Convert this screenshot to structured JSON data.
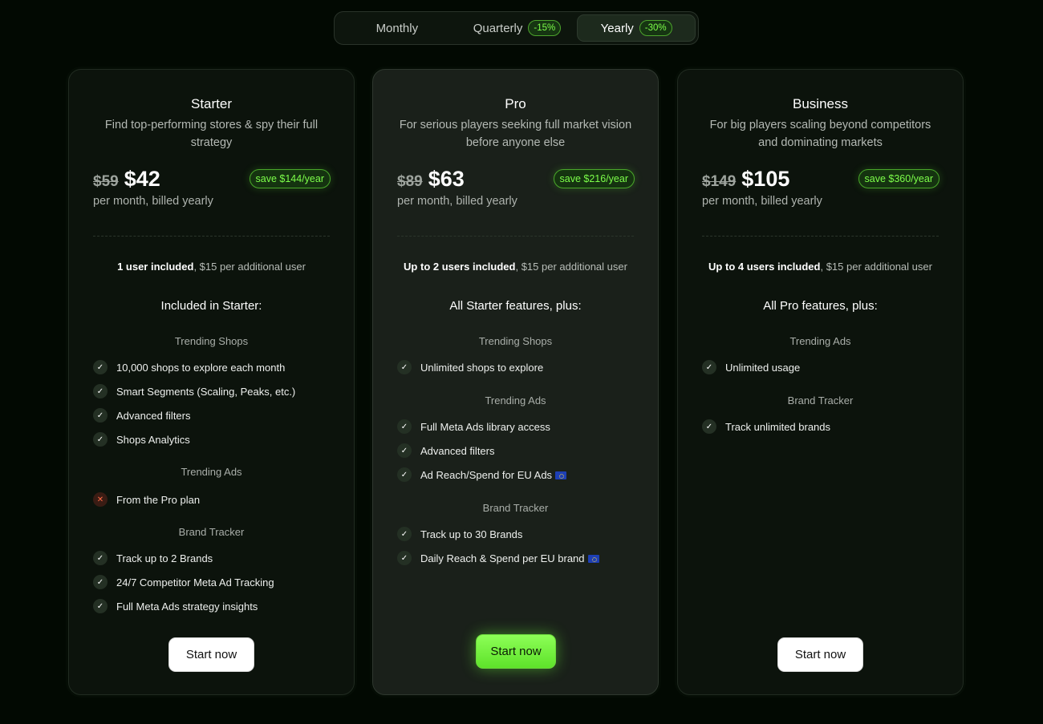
{
  "billing_toggle": {
    "monthly": "Monthly",
    "quarterly": "Quarterly",
    "quarterly_discount": "-15%",
    "yearly": "Yearly",
    "yearly_discount": "-30%",
    "selected": "Yearly"
  },
  "plans": [
    {
      "title": "Starter",
      "description": "Find top-performing stores & spy their full strategy",
      "old_price": "$59",
      "new_price": "$42",
      "save": "save $144/year",
      "billing_note": "per month, billed yearly",
      "users_bold": "1 user included",
      "users_rest": ", $15 per additional user",
      "included_title": "Included in Starter:",
      "sections": [
        {
          "title": "Trending Shops",
          "features": [
            {
              "text": "10,000 shops to explore each month",
              "included": true
            },
            {
              "text": "Smart Segments (Scaling, Peaks, etc.)",
              "included": true
            },
            {
              "text": "Advanced filters",
              "included": true
            },
            {
              "text": "Shops Analytics",
              "included": true
            }
          ]
        },
        {
          "title": "Trending Ads",
          "features": [
            {
              "text": "From the Pro plan",
              "included": false
            }
          ]
        },
        {
          "title": "Brand Tracker",
          "features": [
            {
              "text": "Track up to 2 Brands",
              "included": true
            },
            {
              "text": "24/7 Competitor Meta Ad Tracking",
              "included": true
            },
            {
              "text": "Full Meta Ads strategy insights",
              "included": true
            }
          ]
        }
      ],
      "cta": "Start now"
    },
    {
      "title": "Pro",
      "description": "For serious players seeking full market vision before anyone else",
      "old_price": "$89",
      "new_price": "$63",
      "save": "save $216/year",
      "billing_note": "per month, billed yearly",
      "users_bold": "Up to 2 users included",
      "users_rest": ", $15 per additional user",
      "included_title": "All Starter features, plus:",
      "sections": [
        {
          "title": "Trending Shops",
          "features": [
            {
              "text": "Unlimited shops to explore",
              "included": true
            }
          ]
        },
        {
          "title": "Trending Ads",
          "features": [
            {
              "text": "Full Meta Ads library access",
              "included": true
            },
            {
              "text": "Advanced filters",
              "included": true
            },
            {
              "text": "Ad Reach/Spend for EU Ads",
              "included": true,
              "flag": "eu-flag"
            }
          ]
        },
        {
          "title": "Brand Tracker",
          "features": [
            {
              "text": "Track up to 30 Brands",
              "included": true
            },
            {
              "text": "Daily Reach & Spend per EU brand",
              "included": true,
              "flag": "eu-flag"
            }
          ]
        }
      ],
      "cta": "Start now"
    },
    {
      "title": "Business",
      "description": "For big players scaling beyond competitors and dominating markets",
      "old_price": "$149",
      "new_price": "$105",
      "save": "save $360/year",
      "billing_note": "per month, billed yearly",
      "users_bold": "Up to 4 users included",
      "users_rest": ", $15 per additional user",
      "included_title": "All Pro features, plus:",
      "sections": [
        {
          "title": "Trending Ads",
          "features": [
            {
              "text": "Unlimited usage",
              "included": true
            }
          ]
        },
        {
          "title": "Brand Tracker",
          "features": [
            {
              "text": "Track unlimited brands",
              "included": true
            }
          ]
        }
      ],
      "cta": "Start now"
    }
  ],
  "colors": {
    "background": "#020902",
    "accent_green": "#7dff4a",
    "cta_green": "#6ef23a"
  }
}
